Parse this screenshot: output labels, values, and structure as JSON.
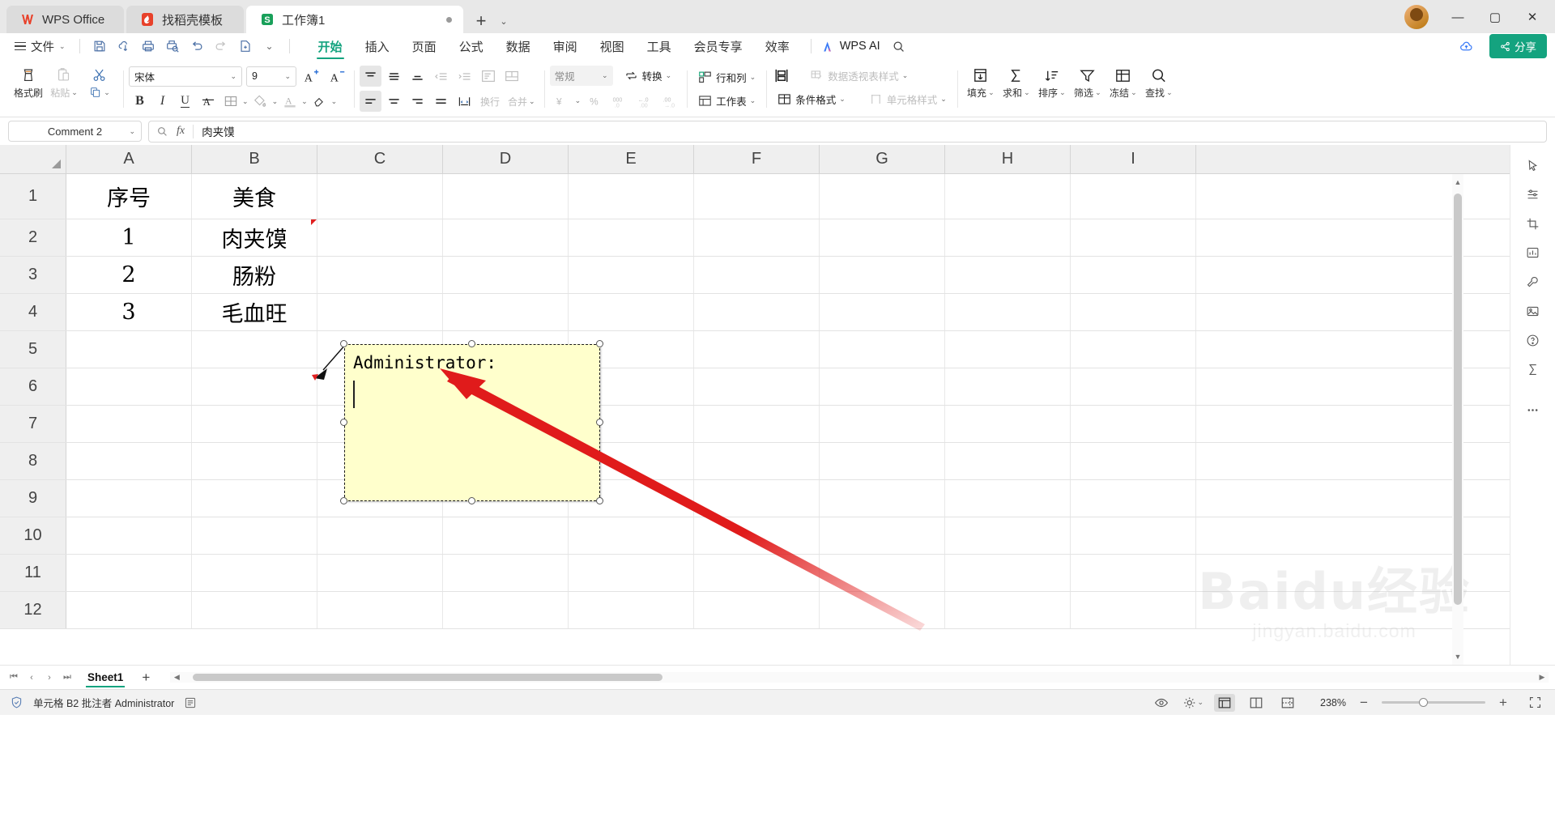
{
  "titlebar": {
    "tabs": [
      {
        "label": "WPS Office",
        "icon": "wps-logo-icon"
      },
      {
        "label": "找稻壳模板",
        "icon": "docer-icon"
      },
      {
        "label": "工作簿1",
        "icon": "spreadsheet-icon"
      }
    ],
    "new_tab": "+",
    "tab_list_caret": "⌄",
    "window_controls": {
      "minimize": "—",
      "maximize": "▢",
      "close": "✕"
    }
  },
  "menubar": {
    "file_label": "文件",
    "file_caret": "⌄",
    "quick_access": [
      "save-icon",
      "cloud-sync-icon",
      "print-icon",
      "print-preview-icon",
      "undo-icon",
      "redo-icon",
      "new-doc-icon",
      "qa-more-caret-icon"
    ],
    "tabs": [
      {
        "label": "开始",
        "active": true
      },
      {
        "label": "插入",
        "active": false
      },
      {
        "label": "页面",
        "active": false
      },
      {
        "label": "公式",
        "active": false
      },
      {
        "label": "数据",
        "active": false
      },
      {
        "label": "审阅",
        "active": false
      },
      {
        "label": "视图",
        "active": false
      },
      {
        "label": "工具",
        "active": false
      },
      {
        "label": "会员专享",
        "active": false
      },
      {
        "label": "效率",
        "active": false
      }
    ],
    "wps_ai": "WPS AI",
    "search_icon": "search-icon",
    "cloud_icon": "cloud-icon",
    "share_label": "分享",
    "accent_color": "#14a37f"
  },
  "toolbar": {
    "format_painter": "格式刷",
    "paste": "粘贴",
    "paste_caret": "⌄",
    "cut": "剪切",
    "copy_caret": "⌄",
    "font_name": "宋体",
    "font_size": "9",
    "grow_font": "A+",
    "shrink_font": "A-",
    "bold": "B",
    "italic": "I",
    "underline": "U",
    "strikethrough": "A",
    "borders": "田",
    "fill_color": "填充颜色",
    "font_color": "字体颜色",
    "clear_format": "清除格式",
    "wrap_text": "换行",
    "merge": "合并",
    "merge_caret": "⌄",
    "number_format": "常规",
    "convert": "转换",
    "convert_caret": "⌄",
    "currency": "¥",
    "percent": "%",
    "comma": "000",
    "dec_increase": "←.0",
    "dec_decrease": ".00",
    "rows_cols": "行和列",
    "rows_cols_caret": "⌄",
    "worksheet": "工作表",
    "worksheet_caret": "⌄",
    "cond_format": "条件格式",
    "cond_format_caret": "⌄",
    "pivot_style": "数据透视表样式",
    "pivot_style_caret": "⌄",
    "cell_style": "单元格样式",
    "cell_style_caret": "⌄",
    "fill": "填充",
    "fill_caret": "⌄",
    "sum": "求和",
    "sum_caret": "⌄",
    "sort": "排序",
    "sort_caret": "⌄",
    "filter": "筛选",
    "filter_caret": "⌄",
    "freeze": "冻结",
    "freeze_caret": "⌄",
    "find": "查找",
    "find_caret": "⌄"
  },
  "formula_bar": {
    "name_box_value": "Comment 2",
    "name_box_caret": "⌄",
    "insert_function_icon": "fx-icon",
    "zoom_icon": "magnifier-icon",
    "fx_label": "fx",
    "content": "肉夹馍"
  },
  "grid": {
    "column_headers": [
      "A",
      "B",
      "C",
      "D",
      "E",
      "F",
      "G",
      "H",
      "I"
    ],
    "row_headers": [
      "1",
      "2",
      "3",
      "4",
      "5",
      "6",
      "7",
      "8",
      "9",
      "10",
      "11",
      "12"
    ],
    "cells": {
      "A1": "序号",
      "B1": "美食",
      "A2": "1",
      "B2": "肉夹馍",
      "A3": "2",
      "B3": "肠粉",
      "A4": "3",
      "B4": "毛血旺"
    },
    "comment_box": {
      "author_line": "Administrator:",
      "anchor_cell": "B2",
      "background": "#ffffcc"
    }
  },
  "sheet_tabs": {
    "first": "⏮",
    "prev": "‹",
    "next": "›",
    "last": "⏭",
    "tabs": [
      {
        "label": "Sheet1",
        "active": true
      }
    ],
    "add_sheet": "+"
  },
  "status_bar": {
    "left_icon": "shield-icon",
    "message": "单元格 B2 批注者 Administrator",
    "doc_icon": "notes-icon",
    "eye_icon": "eye-icon",
    "settings_icon": "settings-icon",
    "view_normal": "normal-view-icon",
    "view_page_layout": "page-layout-icon",
    "view_page_break": "page-break-icon",
    "zoom_level": "238%",
    "zoom_out": "−",
    "zoom_in": "+",
    "fullscreen": "fullscreen-icon"
  },
  "watermark": {
    "main": "Baidu经验",
    "sub": "jingyan.baidu.com"
  }
}
